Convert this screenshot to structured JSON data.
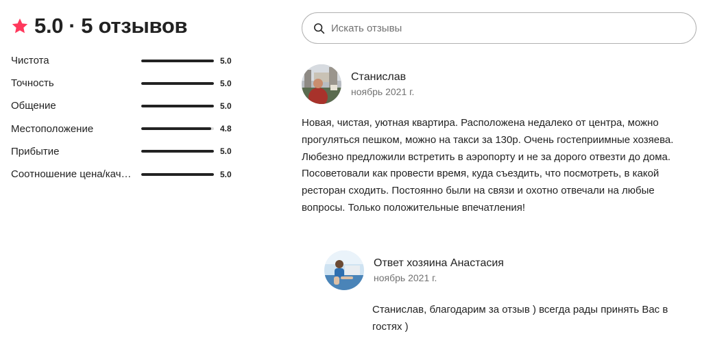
{
  "header": {
    "rating": "5.0",
    "separator": "·",
    "review_count": "5 отзывов",
    "accent_color": "#FF385C",
    "icon": "star-icon"
  },
  "categories": [
    {
      "label": "Чистота",
      "value": "5.0",
      "fraction": 1.0
    },
    {
      "label": "Точность",
      "value": "5.0",
      "fraction": 1.0
    },
    {
      "label": "Общение",
      "value": "5.0",
      "fraction": 1.0
    },
    {
      "label": "Местоположение",
      "value": "4.8",
      "fraction": 0.96
    },
    {
      "label": "Прибытие",
      "value": "5.0",
      "fraction": 1.0
    },
    {
      "label": "Соотношение цена/качество",
      "value": "5.0",
      "fraction": 1.0
    }
  ],
  "search": {
    "placeholder": "Искать отзывы",
    "value": "",
    "icon": "search-icon"
  },
  "review": {
    "author": "Станислав",
    "date": "ноябрь 2021 г.",
    "text": "Новая, чистая, уютная квартира. Расположена недалеко от центра, можно прогуляться пешком, можно на такси за 130р. Очень гостеприимные хозяева. Любезно предложили встретить в аэропорту и не за дорого отвезти до дома. Посоветовали как провести время, куда съездить, что посмотреть, в какой ресторан сходить. Постоянно были на связи и охотно отвечали на любые вопросы. Только положительные впечатления!"
  },
  "reply": {
    "author": "Ответ хозяина Анастасия",
    "date": "ноябрь 2021 г.",
    "text": "Станислав, благодарим за отзыв ) всегда рады принять Вас в гостях )"
  }
}
